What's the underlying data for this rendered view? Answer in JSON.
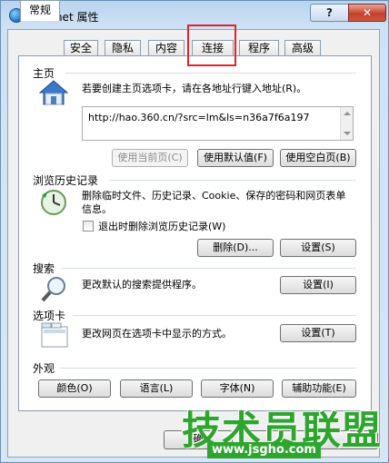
{
  "window": {
    "title": "Internet 属性",
    "help_label": "?",
    "close_label": "✕"
  },
  "tabs": [
    {
      "label": "常规",
      "active": true
    },
    {
      "label": "安全"
    },
    {
      "label": "隐私"
    },
    {
      "label": "内容"
    },
    {
      "label": "连接"
    },
    {
      "label": "程序"
    },
    {
      "label": "高级"
    }
  ],
  "homepage": {
    "section": "主页",
    "description": "若要创建主页选项卡，请在各地址行键入地址(R)。",
    "url": "http://hao.360.cn/?src=lm&ls=n36a7f6a197",
    "buttons": {
      "use_current": "使用当前页(C)",
      "use_default": "使用默认值(F)",
      "use_blank": "使用空白页(B)"
    }
  },
  "history": {
    "section": "浏览历史记录",
    "description": "删除临时文件、历史记录、Cookie、保存的密码和网页表单信息。",
    "checkbox_label": "退出时删除浏览历史记录(W)",
    "delete_button": "删除(D)...",
    "settings_button": "设置(S)"
  },
  "search": {
    "section": "搜索",
    "description": "更改默认的搜索提供程序。",
    "settings_button": "设置(I)"
  },
  "tabs_section": {
    "section": "选项卡",
    "description": "更改网页在选项卡中显示的方式。",
    "settings_button": "设置(T)"
  },
  "appearance": {
    "section": "外观",
    "buttons": {
      "colors": "颜色(O)",
      "languages": "语言(L)",
      "fonts": "字体(N)",
      "accessibility": "辅助功能(E)"
    }
  },
  "footer": {
    "ok_partial": "确"
  },
  "watermark": {
    "text": "技术员联盟",
    "url": "www.jsgho.com"
  }
}
